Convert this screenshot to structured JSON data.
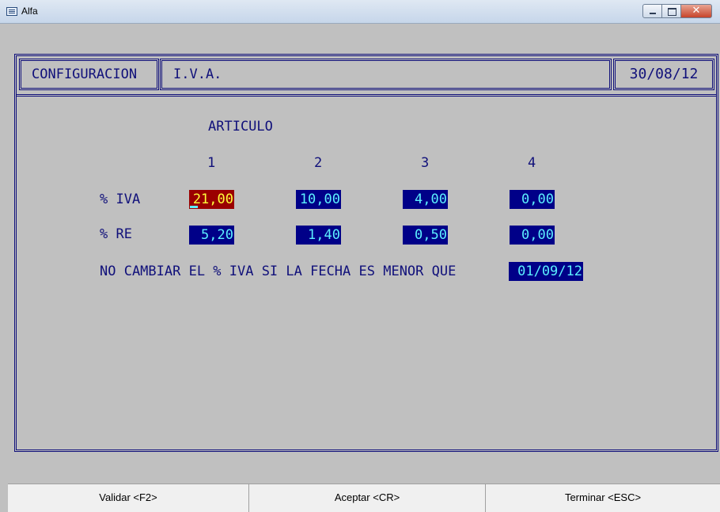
{
  "window": {
    "title": "Alfa",
    "icon": "app-window-icon"
  },
  "header": {
    "section": "CONFIGURACION",
    "title": "I.V.A.",
    "date": "30/08/12"
  },
  "articulo": {
    "label": "ARTICULO",
    "columns": [
      "1",
      "2",
      "3",
      "4"
    ]
  },
  "rows": {
    "iva": {
      "label": "% IVA",
      "values": [
        "21,00",
        "10,00",
        "4,00",
        "0,00"
      ]
    },
    "re": {
      "label": "% RE",
      "values": [
        "5,20",
        "1,40",
        "0,50",
        "0,00"
      ]
    }
  },
  "fecha": {
    "label": "NO CAMBIAR EL % IVA SI LA FECHA ES MENOR QUE",
    "value": "01/09/12"
  },
  "statusbar": {
    "validar": "Validar   <F2>",
    "aceptar": "Aceptar   <CR>",
    "terminar": "Terminar  <ESC>"
  },
  "colors": {
    "frame": "#10107a",
    "field_bg": "#000088",
    "field_text": "#5cf0ff",
    "active_bg": "#9a0000",
    "active_text": "#ffff3a",
    "background": "#c0c0c0"
  }
}
